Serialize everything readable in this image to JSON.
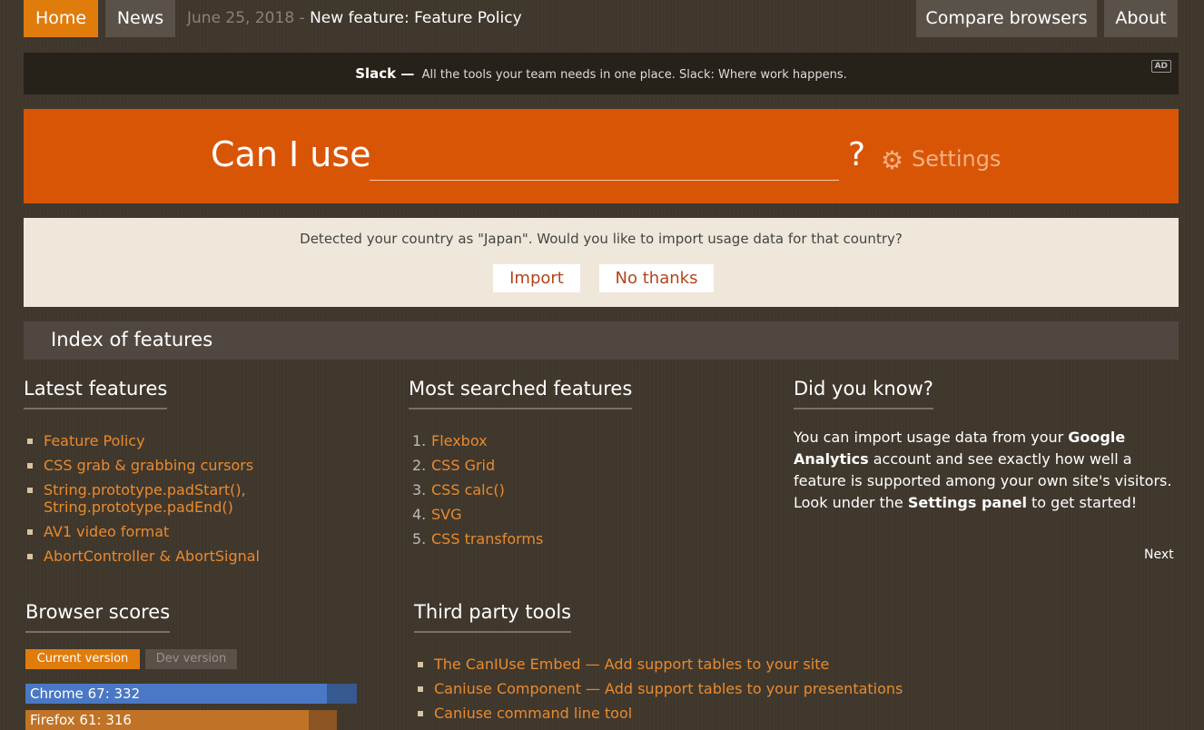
{
  "nav": {
    "home": "Home",
    "news": "News",
    "news_date": "June 25, 2018",
    "news_separator": "-",
    "news_headline": "New feature: Feature Policy",
    "compare": "Compare browsers",
    "about": "About"
  },
  "ad": {
    "brand": "Slack —",
    "text": "All the tools your team needs in one place. Slack: Where work happens.",
    "tag": "AD"
  },
  "search": {
    "prefix": "Can I use",
    "value": "",
    "suffix": "?",
    "settings_label": "Settings",
    "settings_icon": "gear-icon"
  },
  "country_prompt": {
    "message": "Detected your country as \"Japan\". Would you like to import usage data for that country?",
    "import": "Import",
    "no_thanks": "No thanks"
  },
  "index_title": "Index of features",
  "latest": {
    "title": "Latest features",
    "items": [
      "Feature Policy",
      "CSS grab & grabbing cursors",
      "String.prototype.padStart(),",
      "String.prototype.padEnd()",
      "AV1 video format",
      "AbortController & AbortSignal"
    ]
  },
  "most_searched": {
    "title": "Most searched features",
    "items": [
      "Flexbox",
      "CSS Grid",
      "CSS calc()",
      "SVG",
      "CSS transforms"
    ],
    "numbers": [
      "1.",
      "2.",
      "3.",
      "4.",
      "5."
    ]
  },
  "did_you_know": {
    "title": "Did you know?",
    "t1": "You can import usage data from your ",
    "b1": "Google Analytics",
    "t2": " account and see exactly how well a feature is supported among your own site's visitors. Look under the ",
    "b2": "Settings panel",
    "t3": " to get started!",
    "next": "Next"
  },
  "browser_scores": {
    "title": "Browser scores",
    "tabs": [
      "Current version",
      "Dev version"
    ],
    "bars": [
      {
        "label": "Chrome 67: 332",
        "score": 332,
        "color": "#4a78c4",
        "track": "#36598f"
      },
      {
        "label": "Firefox 61: 316",
        "score": 316,
        "color": "#c07326",
        "track": "#8a5522"
      }
    ]
  },
  "third_party": {
    "title": "Third party tools",
    "items": [
      "The CanIUse Embed — Add support tables to your site",
      "Caniuse Component — Add support tables to your presentations",
      "Caniuse command line tool"
    ]
  },
  "colors": {
    "accent": "#e07c0c",
    "search_bg": "#d95506",
    "link": "#e98a2e"
  }
}
